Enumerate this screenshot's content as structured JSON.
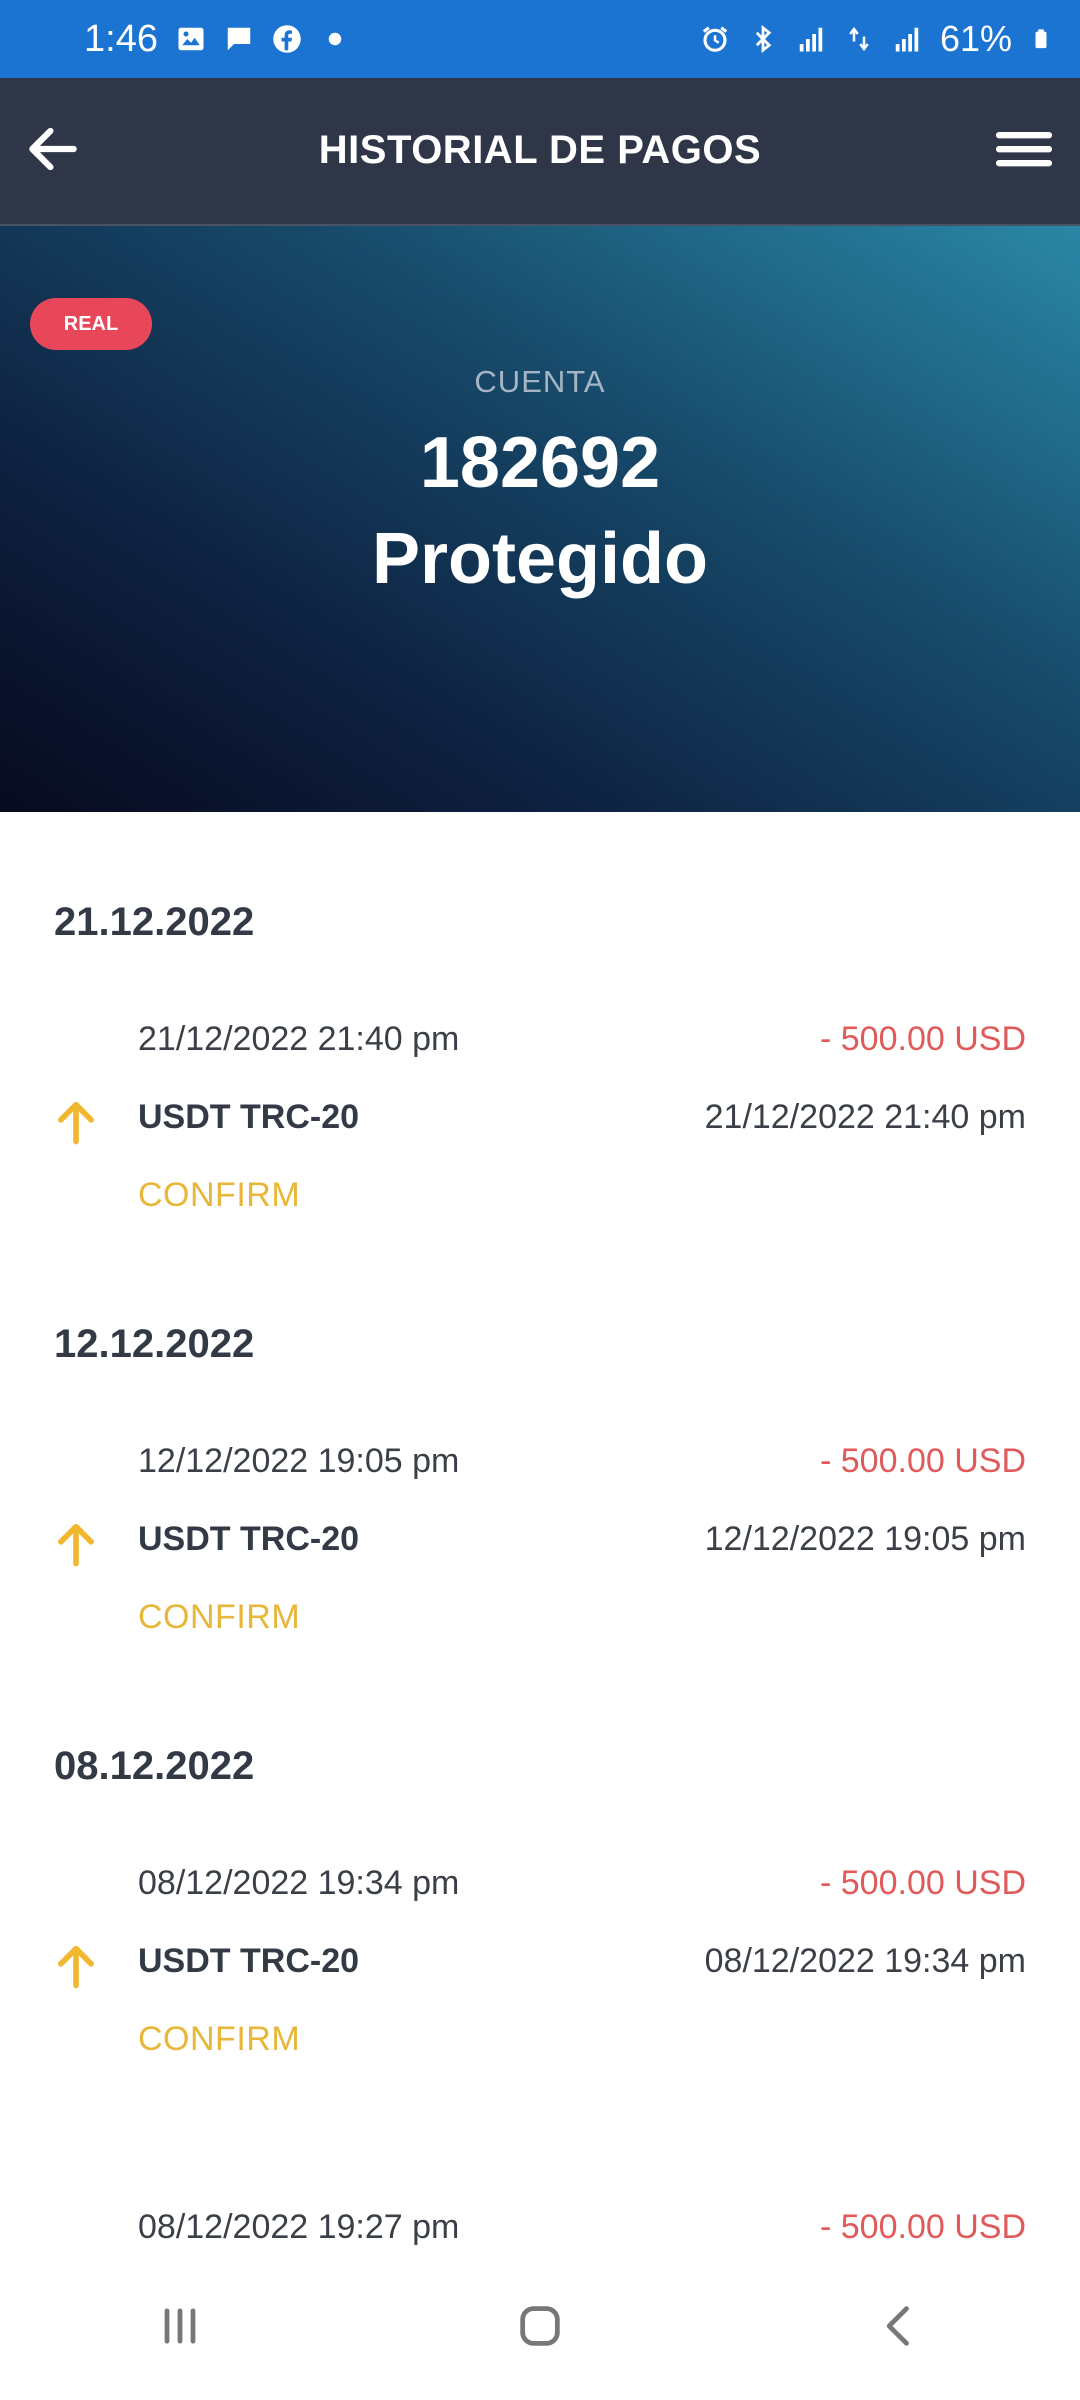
{
  "status_bar": {
    "time": "1:46",
    "battery_pct": "61%",
    "icons_left": [
      "image-icon",
      "message-icon",
      "facebook-icon",
      "dot-icon"
    ],
    "icons_right": [
      "alarm-icon",
      "bluetooth-icon",
      "signal-icon",
      "lte-icon",
      "signal-icon",
      "battery-icon"
    ]
  },
  "app_bar": {
    "title": "HISTORIAL DE PAGOS",
    "back_icon": "arrow-left-icon",
    "menu_icon": "hamburger-menu-icon"
  },
  "hero": {
    "badge": "REAL",
    "label": "CUENTA",
    "account_number": "182692",
    "account_type": "Protegido"
  },
  "groups": [
    {
      "date": "21.12.2022",
      "transactions": [
        {
          "datetime": "21/12/2022 21:40 pm",
          "amount": "- 500.00 USD",
          "method": "USDT TRC-20",
          "datetime_right": "21/12/2022 21:40 pm",
          "status": "CONFIRM"
        }
      ]
    },
    {
      "date": "12.12.2022",
      "transactions": [
        {
          "datetime": "12/12/2022 19:05 pm",
          "amount": "- 500.00 USD",
          "method": "USDT TRC-20",
          "datetime_right": "12/12/2022 19:05 pm",
          "status": "CONFIRM"
        }
      ]
    },
    {
      "date": "08.12.2022",
      "transactions": [
        {
          "datetime": "08/12/2022 19:34 pm",
          "amount": "- 500.00 USD",
          "method": "USDT TRC-20",
          "datetime_right": "08/12/2022 19:34 pm",
          "status": "CONFIRM"
        },
        {
          "datetime": "08/12/2022 19:27 pm",
          "amount": "- 500.00 USD"
        }
      ]
    }
  ],
  "colors": {
    "status_bar": "#1b73d2",
    "app_bar": "#2e3647",
    "badge": "#e8475a",
    "amount": "#e05a5a",
    "confirm": "#e8b73a",
    "arrow": "#f0b72f"
  },
  "nav_bar": {
    "icons": [
      "recent-apps-icon",
      "home-icon",
      "back-icon"
    ]
  }
}
